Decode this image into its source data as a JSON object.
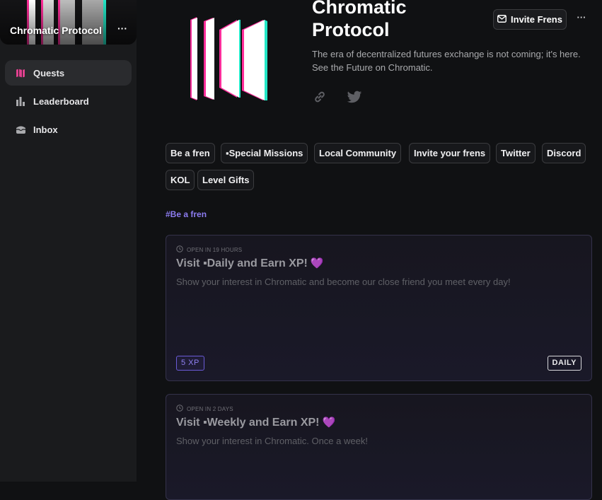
{
  "sidebar": {
    "project_name": "Chromatic Protocol",
    "menu_glyph": "···",
    "nav": [
      {
        "label": "Quests",
        "icon": "map-icon",
        "active": true
      },
      {
        "label": "Leaderboard",
        "icon": "bar-chart-icon",
        "active": false
      },
      {
        "label": "Inbox",
        "icon": "inbox-icon",
        "active": false
      }
    ]
  },
  "header": {
    "title": "Chromatic Protocol",
    "description": "The era of decentralized futures exchange is not coming; it's here. See the Future on Chromatic.",
    "invite_label": "Invite Frens",
    "more_glyph": "···"
  },
  "tags": [
    "Be a fren",
    "▪Special Missions",
    "Local Community",
    "Invite your frens",
    "Twitter",
    "Discord",
    "KOL",
    "Level Gifts"
  ],
  "section_label": "#Be a fren",
  "quests": [
    {
      "open": "Open in 19 hours",
      "title": "Visit ▪Daily and Earn XP!",
      "heart": "💜",
      "description": "Show your interest in Chromatic and become our close friend you meet every day!",
      "xp": "5 XP",
      "frequency": "DAILY"
    },
    {
      "open": "Open in 2 days",
      "title": "Visit ▪Weekly and Earn XP!",
      "heart": "💜",
      "description": "Show your interest in Chromatic. Once a week!",
      "xp": "",
      "frequency": ""
    }
  ],
  "colors": {
    "accent": "#8c7cf0",
    "brand_pink": "#ff2d9a",
    "brand_cyan": "#23e6c6",
    "active_nav_icon": "#e0418f"
  }
}
